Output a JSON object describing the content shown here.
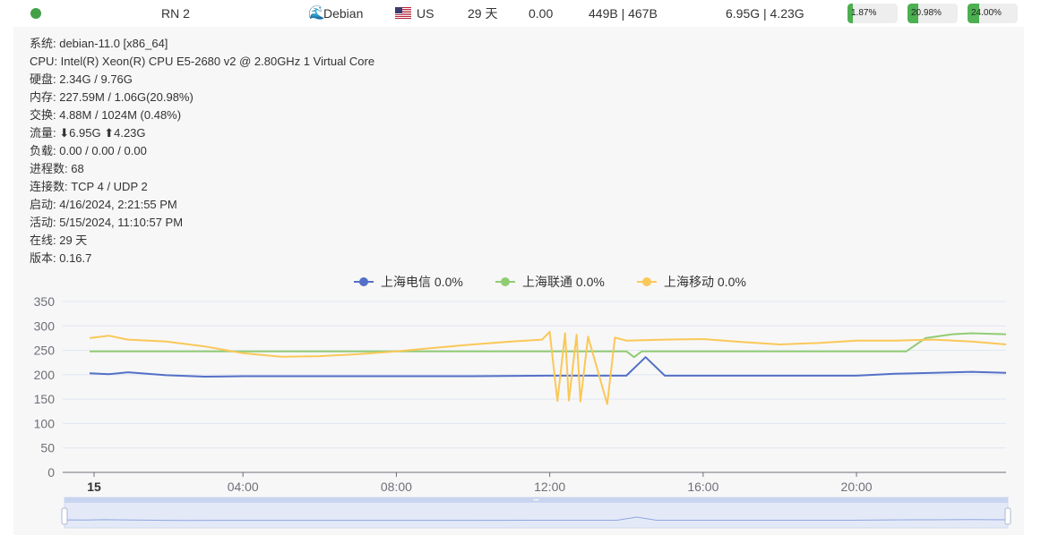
{
  "server": {
    "name": "RN 2",
    "os": "Debian",
    "country": "US",
    "uptime": "29 天",
    "load": "0.00",
    "net_speed": "449B | 467B",
    "traffic": "6.95G | 4.23G",
    "cpu_pct": "1.87%",
    "cpu_value": 1.87,
    "mem_pct": "20.98%",
    "mem_value": 20.98,
    "disk_pct": "24.00%",
    "disk_value": 24.0,
    "status_color": "#43a047"
  },
  "details": {
    "system": "系统: debian-11.0 [x86_64]",
    "cpu": "CPU: Intel(R) Xeon(R) CPU E5-2680 v2 @ 2.80GHz 1 Virtual Core",
    "disk": "硬盘: 2.34G / 9.76G",
    "memory": "内存: 227.59M / 1.06G(20.98%)",
    "swap": "交换: 4.88M / 1024M (0.48%)",
    "traffic_label": "流量:",
    "traffic_down": "6.95G",
    "traffic_up": "4.23G",
    "load": "负载: 0.00 / 0.00 / 0.00",
    "processes": "进程数: 68",
    "connections": "连接数: TCP 4 / UDP 2",
    "boot": "启动: 4/16/2024, 2:21:55 PM",
    "active": "活动: 5/15/2024, 11:10:57 PM",
    "online": "在线: 29 天",
    "version": "版本: 0.16.7"
  },
  "chart_data": {
    "type": "line",
    "y_ticks": [
      "350",
      "300",
      "250",
      "200",
      "150",
      "100",
      "50",
      "0"
    ],
    "ylim": [
      0,
      350
    ],
    "x_ticks": [
      {
        "label": "15",
        "bold": true,
        "hour": 0
      },
      {
        "label": "04:00",
        "bold": false,
        "hour": 4
      },
      {
        "label": "08:00",
        "bold": false,
        "hour": 8
      },
      {
        "label": "12:00",
        "bold": false,
        "hour": 12
      },
      {
        "label": "16:00",
        "bold": false,
        "hour": 16
      },
      {
        "label": "20:00",
        "bold": false,
        "hour": 20
      }
    ],
    "xlim_hours": [
      0,
      23.9
    ],
    "legend_position": "top-center",
    "series": [
      {
        "name": "上海电信 0.0%",
        "color": "#5470c6",
        "points": [
          [
            0,
            203
          ],
          [
            0.5,
            201
          ],
          [
            1,
            205
          ],
          [
            2,
            199
          ],
          [
            3,
            196
          ],
          [
            4,
            197
          ],
          [
            6,
            197
          ],
          [
            8,
            197
          ],
          [
            10,
            197
          ],
          [
            12,
            198
          ],
          [
            13,
            198
          ],
          [
            14,
            198
          ],
          [
            14.5,
            236
          ],
          [
            15,
            198
          ],
          [
            16,
            198
          ],
          [
            18,
            198
          ],
          [
            20,
            198
          ],
          [
            21,
            202
          ],
          [
            22,
            204
          ],
          [
            23,
            206
          ],
          [
            23.9,
            204
          ]
        ]
      },
      {
        "name": "上海联通 0.0%",
        "color": "#91cc75",
        "points": [
          [
            0,
            248
          ],
          [
            2,
            248
          ],
          [
            4,
            248
          ],
          [
            6,
            248
          ],
          [
            8,
            248
          ],
          [
            10,
            248
          ],
          [
            12,
            248
          ],
          [
            14,
            248
          ],
          [
            14.2,
            236
          ],
          [
            14.4,
            248
          ],
          [
            16,
            248
          ],
          [
            18,
            248
          ],
          [
            20,
            248
          ],
          [
            21.3,
            248
          ],
          [
            21.8,
            275
          ],
          [
            22.5,
            283
          ],
          [
            23,
            285
          ],
          [
            23.9,
            283
          ]
        ]
      },
      {
        "name": "上海移动 0.0%",
        "color": "#fac858",
        "points": [
          [
            0,
            275
          ],
          [
            0.5,
            280
          ],
          [
            1,
            272
          ],
          [
            2,
            268
          ],
          [
            3,
            258
          ],
          [
            4,
            244
          ],
          [
            5,
            237
          ],
          [
            6,
            238
          ],
          [
            7,
            242
          ],
          [
            8,
            248
          ],
          [
            9,
            255
          ],
          [
            10,
            262
          ],
          [
            11,
            268
          ],
          [
            11.8,
            272
          ],
          [
            12,
            288
          ],
          [
            12.2,
            146
          ],
          [
            12.4,
            285
          ],
          [
            12.5,
            147
          ],
          [
            12.7,
            282
          ],
          [
            12.8,
            145
          ],
          [
            13,
            278
          ],
          [
            13.5,
            140
          ],
          [
            13.7,
            276
          ],
          [
            14,
            270
          ],
          [
            15,
            272
          ],
          [
            16,
            273
          ],
          [
            17,
            267
          ],
          [
            18,
            262
          ],
          [
            19,
            265
          ],
          [
            20,
            270
          ],
          [
            21,
            270
          ],
          [
            22,
            272
          ],
          [
            23,
            268
          ],
          [
            23.9,
            262
          ]
        ]
      }
    ]
  }
}
